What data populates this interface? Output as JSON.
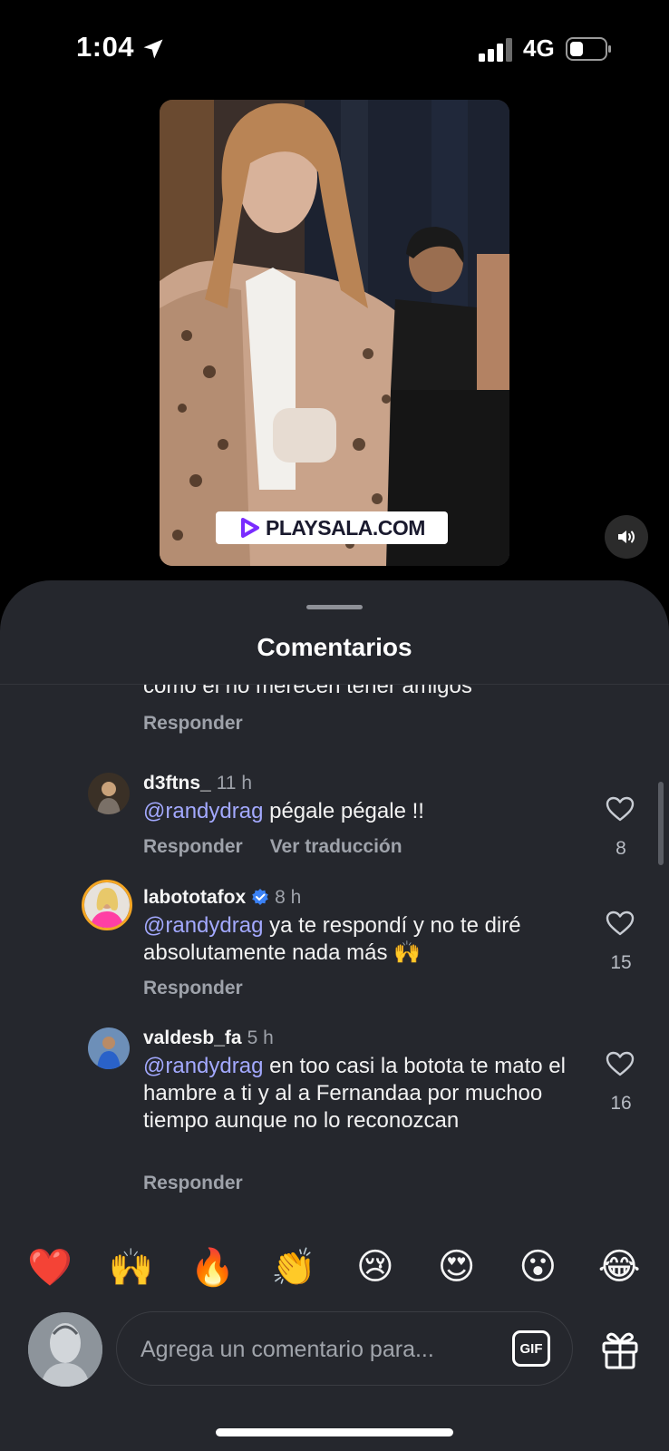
{
  "status_bar": {
    "time": "1:04",
    "network": "4G"
  },
  "video": {
    "watermark": "PLAYSALA.COM"
  },
  "sheet": {
    "title": "Comentarios"
  },
  "partial_comment": {
    "text": "como el no merecen tener amigos",
    "reply_label": "Responder"
  },
  "comments": [
    {
      "username": "d3ftns_",
      "time": "11 h",
      "mention": "@randydrag",
      "text": " pégale pégale !!",
      "reply_label": "Responder",
      "translate_label": "Ver traducción",
      "likes": "8",
      "verified": false
    },
    {
      "username": "labototafox",
      "time": "8 h",
      "mention": "@randydrag",
      "text": " ya te respondí y no te diré absolutamente nada más 🙌",
      "reply_label": "Responder",
      "likes": "15",
      "verified": true
    },
    {
      "username": "valdesb_fa",
      "time": "5 h",
      "mention": "@randydrag",
      "text": " en too casi la botota te mato el hambre a ti y al a Fernandaa por muchoo tiempo aunque no lo reconozcan",
      "reply_label": "Responder",
      "likes": "16",
      "verified": false
    }
  ],
  "emoji_bar": [
    "❤️",
    "🙌",
    "🔥",
    "👏",
    "😢",
    "😍",
    "😮",
    "😂"
  ],
  "composer": {
    "placeholder": "Agrega un comentario para...",
    "gif_label": "GIF"
  },
  "colors": {
    "background": "#000000",
    "sheet": "#25272d",
    "mention": "#a3a9ff",
    "muted": "#9ea2aa",
    "verified": "#3b82f6"
  }
}
